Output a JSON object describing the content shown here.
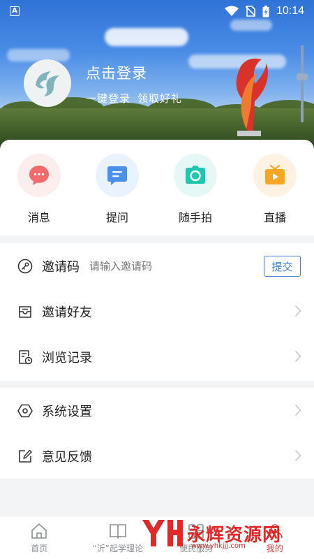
{
  "status": {
    "time": "10:14"
  },
  "profile": {
    "title": "点击登录",
    "subtitle_left": "一键登录",
    "subtitle_right": "领取好礼"
  },
  "quick_actions": [
    {
      "label": "消息",
      "icon": "message-icon",
      "color": "#f26b6b"
    },
    {
      "label": "提问",
      "icon": "question-icon",
      "color": "#4a90e8"
    },
    {
      "label": "随手拍",
      "icon": "camera-icon",
      "color": "#1fc7b2"
    },
    {
      "label": "直播",
      "icon": "tv-icon",
      "color": "#f5a623"
    }
  ],
  "menu_group_1": {
    "invite_code_label": "邀请码",
    "invite_code_placeholder": "请输入邀请码",
    "submit_label": "提交",
    "invite_friends_label": "邀请好友",
    "history_label": "浏览记录"
  },
  "menu_group_2": {
    "settings_label": "系统设置",
    "feedback_label": "意见反馈"
  },
  "bottom_nav": [
    {
      "label": "首页"
    },
    {
      "label": "“沂”起学理论"
    },
    {
      "label": "便民服务"
    },
    {
      "label": "我的"
    }
  ],
  "watermark": {
    "text": "永辉资源网",
    "url": "www.yhkjjj.com"
  },
  "colors": {
    "accent": "#3b82d8",
    "active": "#e23b3b"
  }
}
